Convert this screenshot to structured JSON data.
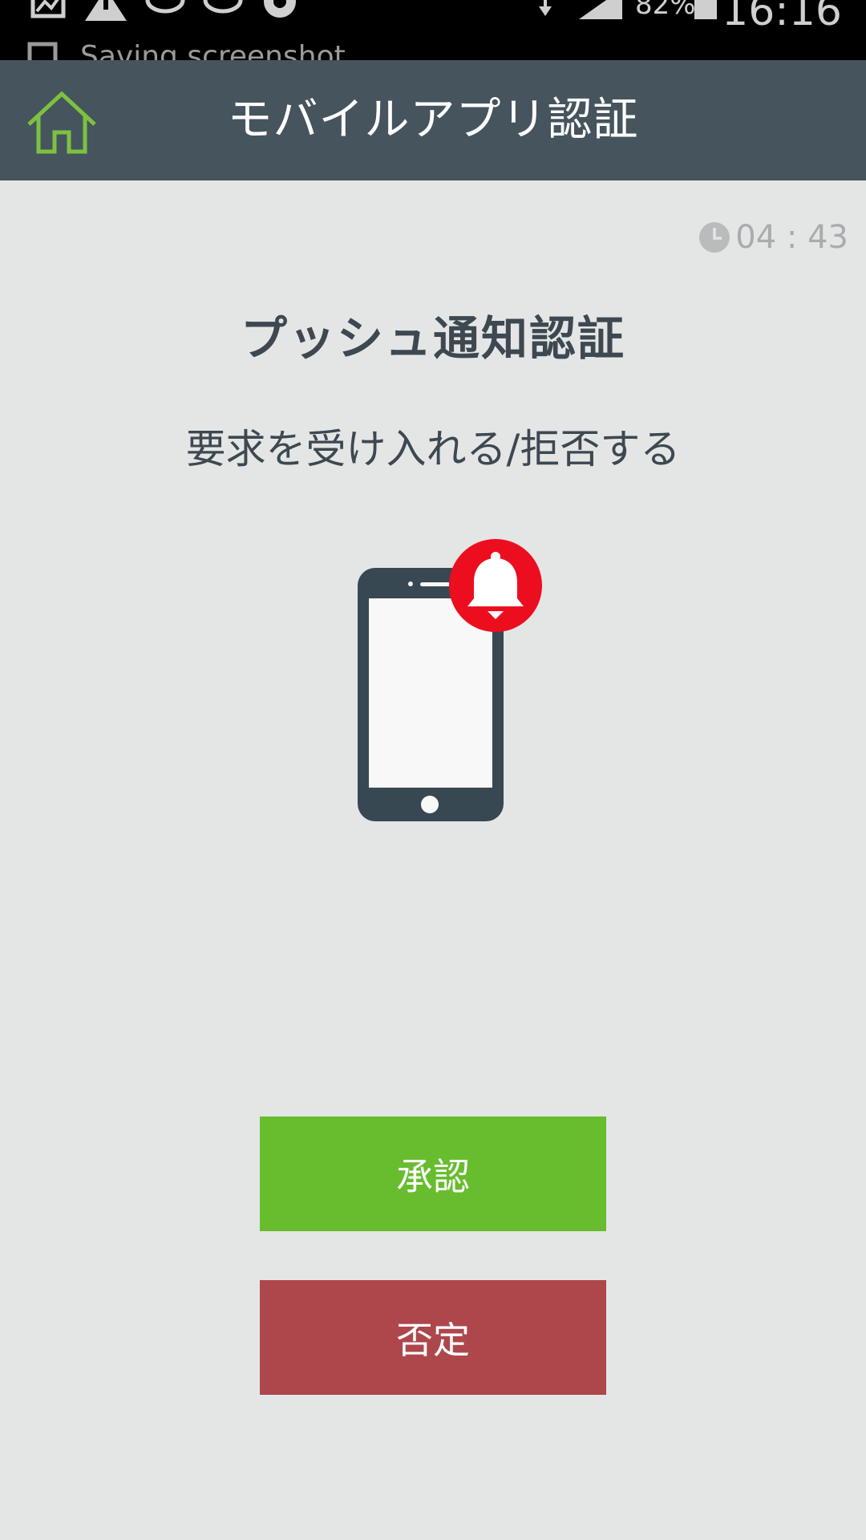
{
  "status_bar": {
    "notification_text": "Saving screenshot",
    "battery_percent": "82%",
    "time": "16:16"
  },
  "app_bar": {
    "title": "モバイルアプリ認証",
    "home_icon": "home-icon"
  },
  "timer": {
    "value": "04 : 43",
    "icon": "clock-icon"
  },
  "content": {
    "heading": "プッシュ通知認証",
    "subheading": "要求を受け入れる/拒否する",
    "illustration": "phone-with-bell-icon"
  },
  "actions": {
    "approve_label": "承認",
    "deny_label": "否定"
  },
  "colors": {
    "app_bar": "#46545d",
    "background": "#e4e6e6",
    "approve": "#67bd2e",
    "deny": "#ad474c",
    "bell_badge": "#ec0e1e",
    "home_icon": "#7cc240"
  }
}
